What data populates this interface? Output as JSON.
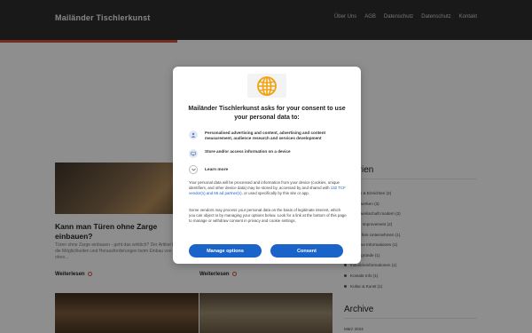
{
  "header": {
    "brand": "Mailänder Tischlerkunst",
    "nav": [
      "Über Uns",
      "AGB",
      "Datenschutz",
      "Datenschutz",
      "Kontakt"
    ]
  },
  "posts": [
    {
      "title": "Kann man Türen ohne Zarge einbauen?",
      "excerpt": "Türen ohne Zarge einbauen - geht das wirklich? Der Artikel beleuchtet die Möglichkeiten und Herausforderungen beim Einbau von Türen ohne...",
      "read_more": "Weiterlesen"
    },
    {
      "read_more": "Weiterlesen"
    }
  ],
  "sidebar": {
    "categories_heading": "egorien",
    "categories": [
      "Bauen & Einrichten (2)",
      "Handwerken (3)",
      "Handwerkschaft modern (2)",
      "Home Improvement (2)",
      "Ideen fürs Unternehmen (1)",
      "Kreative Informationen (1)",
      "Hintergründe (1)",
      "Industrieinformationen (1)",
      "Kontakt Info (1)",
      "Kultur & Kunst (1)"
    ],
    "archive_heading": "Archive",
    "archive_item": "März 2024"
  },
  "consent": {
    "title": "Mailänder Tischlerkunst asks for your consent to use your personal data to:",
    "purposes": [
      {
        "icon": "person-icon",
        "text": "Personalised advertising and content, advertising and content measurement, audience research and services development"
      },
      {
        "icon": "device-icon",
        "text": "Store and/or access information on a device"
      }
    ],
    "learn_more": "Learn more",
    "body1_pre": "Your personal data will be processed and information from your device (cookies, unique identifiers, and other device data) may be stored by, accessed by and shared with ",
    "body1_link": "132 TCF vendor(s) and 65 ad partner(s)",
    "body1_post": ", or used specifically by this site or app.",
    "body2": "Some vendors may process your personal data on the basis of legitimate interest, which you can object to by managing your options below. Look for a link at the bottom of this page to manage or withdraw consent in privacy and cookie settings.",
    "manage_label": "Manage options",
    "consent_label": "Consent"
  },
  "colors": {
    "header_bg": "#2b2b2b",
    "accent": "#c9503a",
    "primary_button": "#1a63c9",
    "logo_globe": "#f2a20c"
  }
}
